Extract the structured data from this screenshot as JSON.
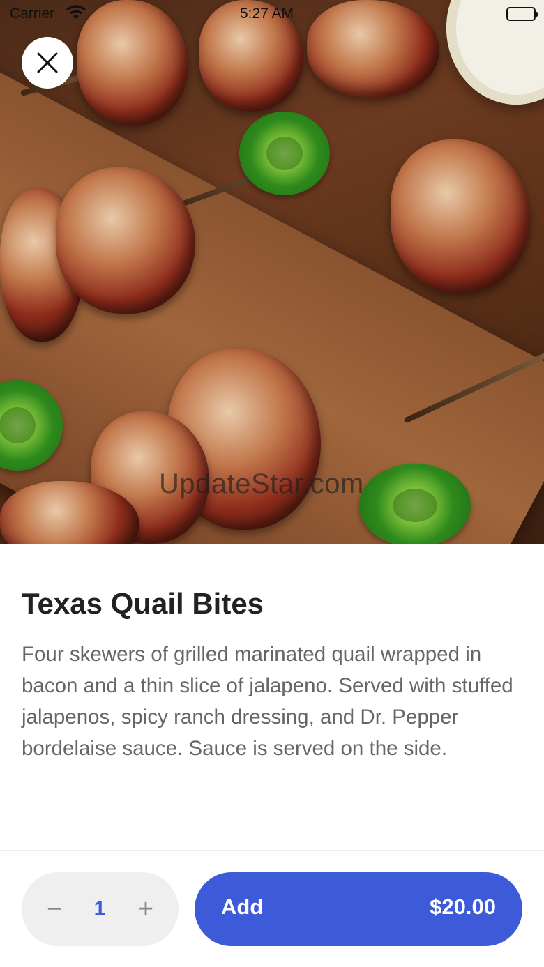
{
  "status_bar": {
    "carrier": "Carrier",
    "time": "5:27 AM"
  },
  "hero": {
    "image_name": "texas-quail-bites-photo",
    "watermark": "UpdateStar.com"
  },
  "item": {
    "title": "Texas Quail Bites",
    "description": "Four skewers of grilled marinated quail wrapped in bacon and a thin slice of jalapeno. Served with stuffed jalapenos, spicy ranch dressing, and Dr. Pepper bordelaise sauce. Sauce is served on the side."
  },
  "footer": {
    "quantity": "1",
    "minus_symbol": "−",
    "plus_symbol": "+",
    "add_label": "Add",
    "price": "$20.00"
  },
  "colors": {
    "accent": "#3d5bd9",
    "title_text": "#222222",
    "body_text": "#666666",
    "stepper_bg": "#efefef"
  },
  "icons": {
    "close": "close-icon",
    "wifi": "wifi-icon",
    "battery": "battery-icon"
  }
}
